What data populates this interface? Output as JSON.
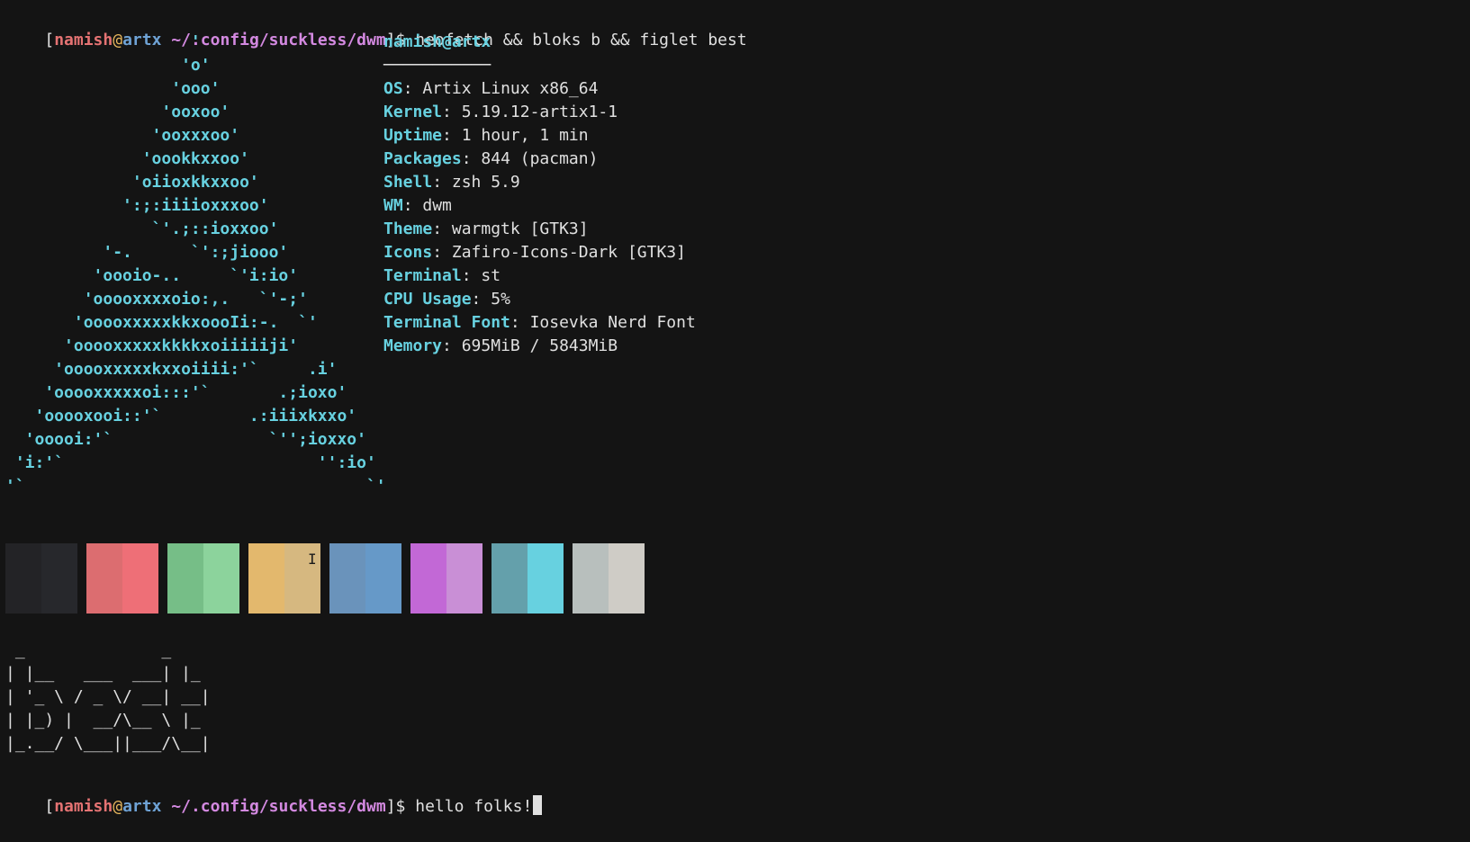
{
  "prompt": {
    "open_bracket": "[",
    "user": "namish",
    "at": "@",
    "host": "artx",
    "path": "~/.config/suckless/dwm",
    "close_bracket": "]",
    "dollar": "$"
  },
  "command_1": "neofetch && bloks b && figlet best",
  "logo_ascii": "                   '\n                  'o'\n                 'ooo'\n                'ooxoo'\n               'ooxxxoo'\n              'oookkxxoo'\n             'oiioxkkxxoo'\n            ':;:iiiioxxxoo'\n               `'.;::ioxxoo'\n          '-.      `':;jiooo'\n         'oooio-..     `'i:io'\n        'ooooxxxxoio:,.   `'-;'\n       'ooooxxxxxkkxoooIi:-.  `'\n      'ooooxxxxxkkkkxoiiiiiji'\n     'ooooxxxxxkxxoiiii:'`     .i'\n    'ooooxxxxxoi:::'`       .;ioxo'\n   'ooooxooi::'`         .:iiixkxxo'\n  'ooooi:'`                `'';ioxxo'\n 'i:'`                          '':io'\n'`                                   `'",
  "info": {
    "user": "namish",
    "at": "@",
    "host": "artx",
    "separator": "───────────",
    "rows": [
      {
        "key": "OS",
        "value": "Artix Linux x86_64"
      },
      {
        "key": "Kernel",
        "value": "5.19.12-artix1-1"
      },
      {
        "key": "Uptime",
        "value": "1 hour, 1 min"
      },
      {
        "key": "Packages",
        "value": "844 (pacman)"
      },
      {
        "key": "Shell",
        "value": "zsh 5.9"
      },
      {
        "key": "WM",
        "value": "dwm"
      },
      {
        "key": "Theme",
        "value": "warmgtk [GTK3]"
      },
      {
        "key": "Icons",
        "value": "Zafiro-Icons-Dark [GTK3]"
      },
      {
        "key": "Terminal",
        "value": "st"
      },
      {
        "key": "CPU Usage",
        "value": "5%"
      },
      {
        "key": "Terminal Font",
        "value": "Iosevka Nerd Font"
      },
      {
        "key": "Memory",
        "value": "695MiB / 5843MiB"
      }
    ]
  },
  "palette": [
    [
      "#232326",
      "#27282c"
    ],
    [
      "#dc6d70",
      "#ee6f77"
    ],
    [
      "#76be87",
      "#8cd39c"
    ],
    [
      "#e3b86d",
      "#d6b880"
    ],
    [
      "#6a93bb",
      "#6699c8"
    ],
    [
      "#c268d6",
      "#c98fd6"
    ],
    [
      "#64a0ab",
      "#67d1e0"
    ],
    [
      "#b8bfbd",
      "#cfccc6"
    ]
  ],
  "figlet": " _              _   \n| |__   ___  ___| |_ \n| '_ \\ / _ \\/ __| __|\n| |_) |  __/\\__ \\ |_ \n|_.__/ \\___||___/\\__|",
  "command_2": "hello folks!",
  "colors": {
    "background": "#141414",
    "accent": "#67d1e0",
    "user": "#e57373",
    "host": "#6fa3d6",
    "path": "#d389e0"
  }
}
